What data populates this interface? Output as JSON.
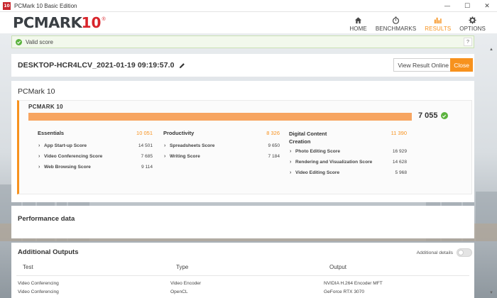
{
  "window": {
    "title": "PCMark 10 Basic Edition",
    "app_icon_text": "10",
    "minimize_symbol": "—",
    "maximize_symbol": "☐",
    "close_symbol": "✕"
  },
  "header": {
    "logo_main": "PCMARK",
    "logo_number": "10",
    "logo_reg": "®",
    "nav": [
      {
        "label": "HOME",
        "icon": "home-icon",
        "active": false
      },
      {
        "label": "BENCHMARKS",
        "icon": "stopwatch-icon",
        "active": false
      },
      {
        "label": "RESULTS",
        "icon": "bar-chart-icon",
        "active": true
      },
      {
        "label": "OPTIONS",
        "icon": "gear-icon",
        "active": false
      }
    ]
  },
  "status": {
    "valid_text": "Valid score",
    "help_label": "?"
  },
  "result": {
    "name": "DESKTOP-HCR4LCV_2021-01-19 09:19:57.0",
    "view_online_label": "View Result Online",
    "close_label": "Close"
  },
  "main_card": {
    "title": "PCMark 10",
    "box_title": "PCMARK 10",
    "total_score": "7 055",
    "score_fill_fraction": 1.0,
    "groups": [
      {
        "name": "Essentials",
        "score": "10 051",
        "items": [
          {
            "name": "App Start-up Score",
            "value": "14 501"
          },
          {
            "name": "Video Conferencing Score",
            "value": "7 685"
          },
          {
            "name": "Web Browsing Score",
            "value": "9 114"
          }
        ]
      },
      {
        "name": "Productivity",
        "score": "8 326",
        "items": [
          {
            "name": "Spreadsheets Score",
            "value": "9 650"
          },
          {
            "name": "Writing Score",
            "value": "7 184"
          }
        ]
      },
      {
        "name": "Digital Content",
        "name_line2": "Creation",
        "score": "11 390",
        "items": [
          {
            "name": "Photo Editing Score",
            "value": "16 929"
          },
          {
            "name": "Rendering and Visualization Score",
            "value": "14 628"
          },
          {
            "name": "Video Editing Score",
            "value": "5 968"
          }
        ]
      }
    ]
  },
  "performance": {
    "title": "Performance data"
  },
  "outputs": {
    "title": "Additional Outputs",
    "details_label": "Additional details",
    "columns": [
      "Test",
      "Type",
      "Output"
    ],
    "rows": [
      {
        "test": "Video Conferencing",
        "type": "Video Encoder",
        "output": "NVIDIA H.264 Encoder MFT"
      },
      {
        "test": "Video Conferencing",
        "type": "OpenCL",
        "output": "GeForce RTX 3070"
      }
    ]
  },
  "colors": {
    "accent": "#f7921e",
    "bar": "#f7a561",
    "ok": "#5bb33e",
    "brand_red": "#d8242b"
  }
}
